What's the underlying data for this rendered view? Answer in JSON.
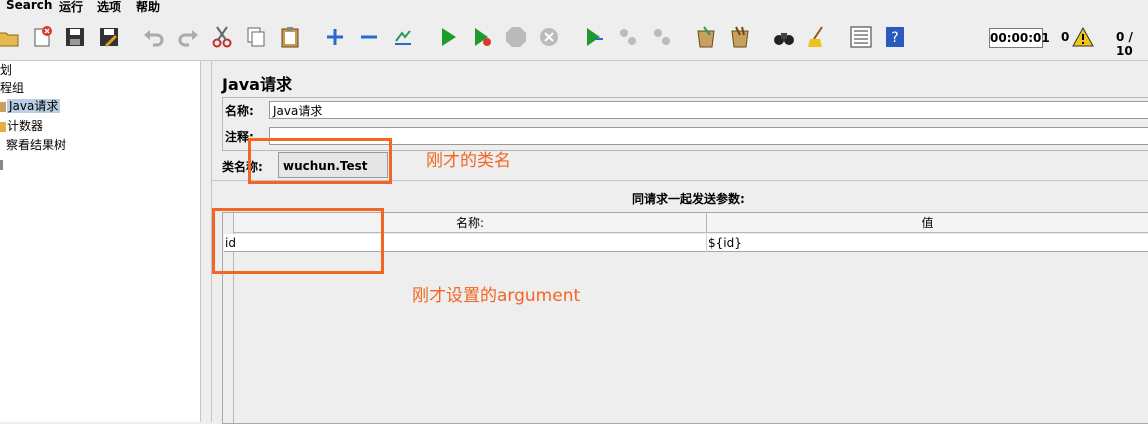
{
  "menu": {
    "search": "Search",
    "run": "运行",
    "options": "选项",
    "help": "帮助"
  },
  "toolbar": {
    "icons": [
      "open-icon",
      "close-icon",
      "save-icon",
      "save-as-icon",
      "undo-icon",
      "redo-icon",
      "cut-icon",
      "copy-icon",
      "paste-icon",
      "expand-icon",
      "collapse-icon",
      "toggle-icon",
      "start-icon",
      "start-no-pause-icon",
      "stop-icon",
      "shutdown-icon",
      "remote-start-icon",
      "remote-stop-icon",
      "remote-shutdown-icon",
      "clear-icon",
      "clear-all-icon",
      "search-icon",
      "reset-search-icon",
      "function-helper-icon",
      "help-icon"
    ],
    "timer": "00:00:01",
    "error_count": "0",
    "threads": "0 / 10"
  },
  "tree": {
    "items": [
      {
        "label": "划"
      },
      {
        "label": "程组"
      },
      {
        "label": "Java请求",
        "selected": true
      },
      {
        "label": "计数器"
      },
      {
        "label": "察看结果树"
      }
    ]
  },
  "main": {
    "title": "Java请求",
    "name_label": "名称:",
    "name_value": "Java请求",
    "comment_label": "注释:",
    "comment_value": "",
    "classname_label": "类名称:",
    "classname_value": "wuchun.Test",
    "params_title": "同请求一起发送参数:",
    "columns": [
      "名称:",
      "值"
    ],
    "rows": [
      {
        "name": "id",
        "value": "${id}"
      }
    ]
  },
  "annotations": {
    "classname_note": "刚才的类名",
    "argument_note": "刚才设置的argument",
    "color": "#f26522"
  }
}
